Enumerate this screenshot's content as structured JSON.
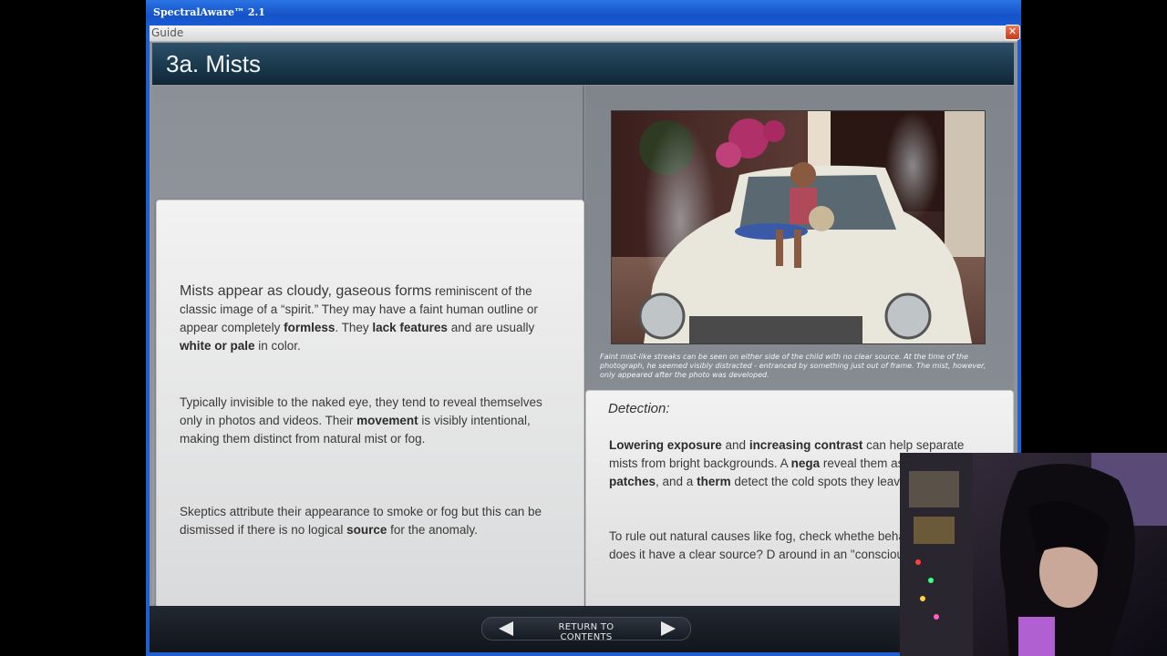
{
  "window": {
    "title": "SpectralAware™ 2.1"
  },
  "guidebar": {
    "label": "Guide",
    "close": "✕"
  },
  "header": {
    "title": "3a. Mists"
  },
  "left": {
    "p1": {
      "a": "Mists appear as cloudy, gaseous forms",
      "b": " reminiscent of the classic image of a “spirit.” They may have a faint human outline or appear completely ",
      "c": "formless",
      "d": ". They ",
      "e": "lack features",
      "f": " and are usually ",
      "g": "white or pale",
      "h": " in color."
    },
    "p2": {
      "a": "Typically invisible to the naked eye, they tend to reveal themselves only in photos and videos. Their ",
      "b": "movement",
      "c": " is visibly intentional, making them distinct from natural mist or fog."
    },
    "p3": {
      "a": "Skeptics attribute their appearance to smoke or fog but this can be dismissed if there is no logical ",
      "b": "source",
      "c": " for the anomaly."
    }
  },
  "right": {
    "caption": "Faint mist-like streaks can be seen on either side of the child with no clear source. At the time of the photograph, he seemed visibly distracted - entranced by something just out of frame. The mist, however, only appeared after the photo was developed.",
    "detection": {
      "title": "Detection:",
      "p1": {
        "a": "Lowering exposure",
        "b": " and ",
        "c": "increasing contrast",
        "d": " can help separate mists from bright backgrounds. A ",
        "e": "nega",
        "f": " reveal them as ",
        "g": "darkened patches",
        "h": ", and a ",
        "i": "therm",
        "j": " detect the cold spots they leave behind."
      },
      "p2": "To rule out natural causes like fog, check whethe behaves logically - does it have a clear source? D around in an \"conscious\" manner?"
    }
  },
  "nav": {
    "label": "RETURN TO CONTENTS"
  }
}
